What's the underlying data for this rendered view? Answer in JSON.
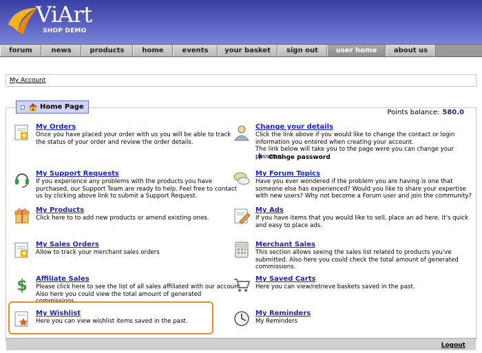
{
  "brand": {
    "name": "ViArt",
    "subtitle": "SHOP DEMO"
  },
  "nav": [
    {
      "label": "forum"
    },
    {
      "label": "news"
    },
    {
      "label": "products"
    },
    {
      "label": "home"
    },
    {
      "label": "events"
    },
    {
      "label": "your basket"
    },
    {
      "label": "sign out"
    },
    {
      "label": "user home",
      "active": true
    },
    {
      "label": "about us"
    }
  ],
  "breadcrumb": {
    "label": "My Account"
  },
  "panel": {
    "tab_label": "Home Page",
    "points_label": "Points balance:",
    "points_value": "580.0"
  },
  "items": {
    "orders": {
      "title": "My Orders",
      "desc": "Once you have placed your order with us you will be able to track the status of your order and review the order details."
    },
    "change_details": {
      "title": "Change your details",
      "desc": "Click the link above if you would like to change the contact or login information you entered when creating your account.",
      "desc2": "The link below will take you to the page were you can change your password"
    },
    "change_password": {
      "label": "Change password"
    },
    "support": {
      "title": "My Support Requests",
      "desc": "If you experience any problems with the products you have purchased, our Support Team are ready to help. Feel free to contact us by clicking above link to submit a Support Request."
    },
    "forum_topics": {
      "title": "My Forum Topics",
      "desc": "Have you ever wondered if the problem you are having is one that someone else has experienced? Would you like to share your expertise with new users? Why not become a Forum user and join the community?"
    },
    "products": {
      "title": "My Products",
      "desc": "Click here to to add new products or amend existing ones."
    },
    "ads": {
      "title": "My Ads",
      "desc": "If you have items that you would like to sell, place an ad here. It's quick and easy to place ads."
    },
    "sales_orders": {
      "title": "My Sales Orders",
      "desc": "Allow to track your merchant sales orders"
    },
    "merchant_sales": {
      "title": "Merchant Sales",
      "desc": "This section allows seeing the sales list related to products you've submitted. Also here you could check the total amount of generated commissions."
    },
    "affiliate": {
      "title": "Affiliate Sales",
      "desc": "Please click here to see the list of all sales affiliated with our account. Also here you could view the total amount of generated commissions."
    },
    "saved_carts": {
      "title": "My Saved Carts",
      "desc": "Here you can view/retrieve baskets saved in the past."
    },
    "wishlist": {
      "title": "My Wishlist",
      "desc": "Here you can view wishlist items saved in the past."
    },
    "reminders": {
      "title": "My Reminders",
      "desc": "My Reminders"
    }
  },
  "footer": {
    "logout": "Logout"
  },
  "colors": {
    "accent_link": "#1a24c8",
    "highlight": "#f08a1e",
    "header": "#4a52b5"
  }
}
